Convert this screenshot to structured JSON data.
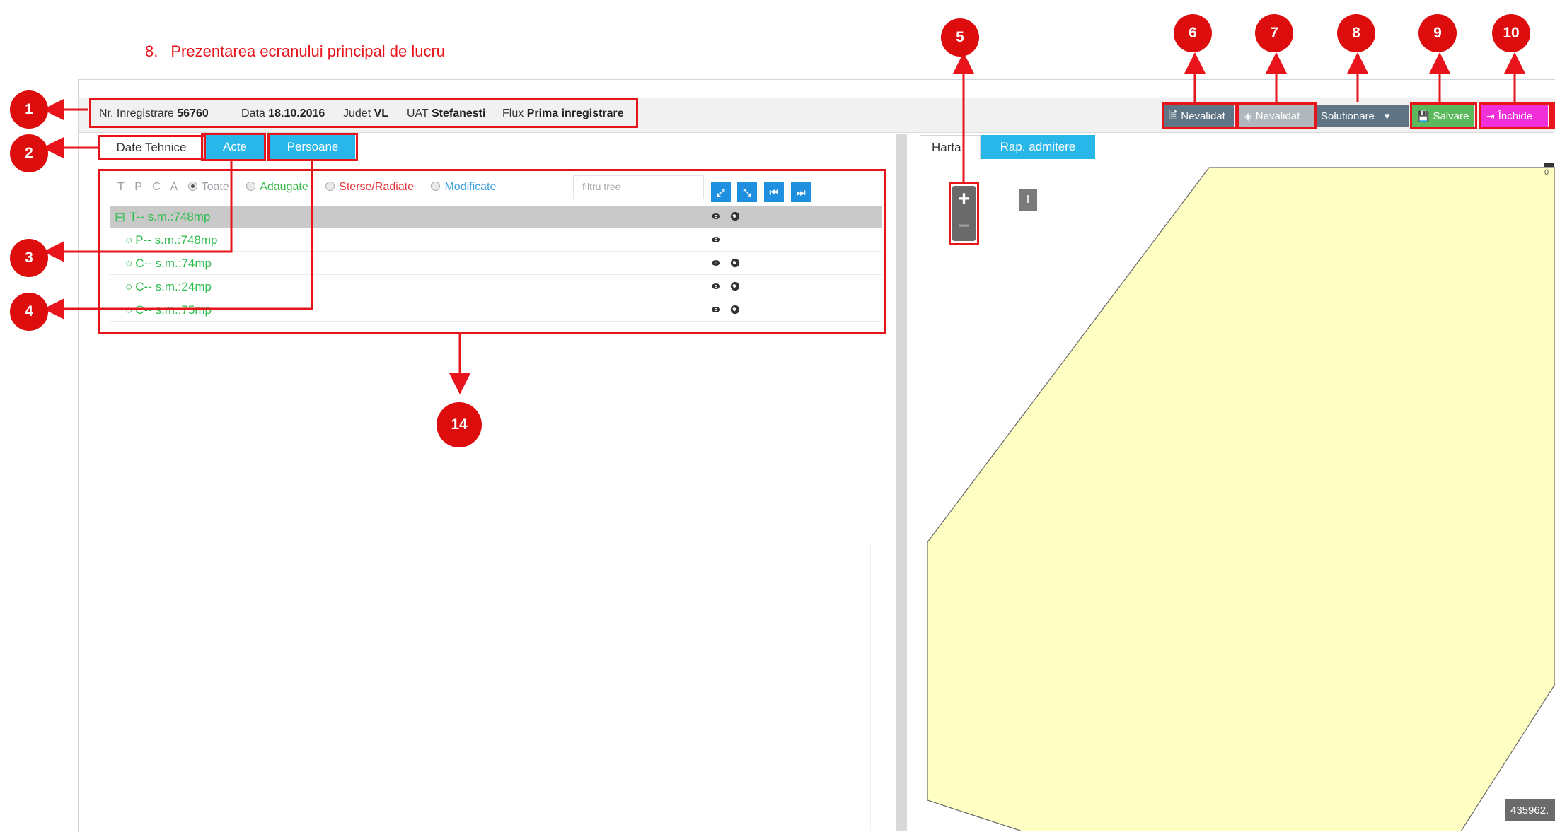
{
  "document": {
    "section_number": "8.",
    "section_title": "Prezentarea ecranului principal de lucru"
  },
  "infobar": {
    "nr_label": "Nr. Inregistrare",
    "nr_value": "56760",
    "data_label": "Data",
    "data_value": "18.10.2016",
    "judet_label": "Judet",
    "judet_value": "VL",
    "uat_label": "UAT",
    "uat_value": "Stefanesti",
    "flux_label": "Flux",
    "flux_value": "Prima inregistrare"
  },
  "toolbar": {
    "btn_nevalidat_1": "Nevalidat",
    "btn_nevalidat_2": "Nevalidat",
    "btn_solutionare": "Solutionare",
    "btn_salvare": "Salvare",
    "btn_inchide": "Închide",
    "colors": {
      "nevalidat_1": "#5f7484",
      "nevalidat_2": "#b0b8be",
      "solutionare": "#5f7484",
      "salvare": "#5cb85c",
      "inchide": "#f02fd8"
    }
  },
  "left_tabs": [
    "Date Tehnice",
    "Acte",
    "Persoane"
  ],
  "tree_filters": {
    "letters": [
      "T",
      "P",
      "C",
      "A"
    ],
    "options": [
      {
        "label": "Toate",
        "color": "#9aa0a6",
        "selected": true
      },
      {
        "label": "Adaugate",
        "color": "#3cb94e",
        "selected": false
      },
      {
        "label": "Sterse/Radiate",
        "color": "#e8363b",
        "selected": false
      },
      {
        "label": "Modificate",
        "color": "#3aa1e0",
        "selected": false
      }
    ],
    "search_placeholder": "filtru tree",
    "action_icons": [
      "expand-icon",
      "collapse-icon",
      "first-icon",
      "last-icon"
    ],
    "action_glyphs": [
      "⤢",
      "⤡",
      "⏮",
      "⏭"
    ]
  },
  "tree_rows": [
    {
      "prefix": "⊟",
      "label": "T-- s.m.:748mp",
      "eye": true,
      "globe": true,
      "selected": true
    },
    {
      "prefix": "○",
      "label": "P-- s.m.:748mp",
      "eye": true,
      "globe": false,
      "selected": false
    },
    {
      "prefix": "○",
      "label": "C-- s.m.:74mp",
      "eye": true,
      "globe": true,
      "selected": false
    },
    {
      "prefix": "○",
      "label": "C-- s.m.:24mp",
      "eye": true,
      "globe": true,
      "selected": false
    },
    {
      "prefix": "○",
      "label": "C-- s.m.:75mp",
      "eye": true,
      "globe": true,
      "selected": false
    }
  ],
  "right_tabs": [
    "Harta",
    "Rap. admitere"
  ],
  "map": {
    "zoom_in": "+",
    "zoom_out": "−",
    "tool_label": "I",
    "coordinate": "435962.",
    "scale_label": "0",
    "polygon_color": "#ffffc4"
  },
  "markers": [
    "1",
    "2",
    "3",
    "4",
    "5",
    "6",
    "7",
    "8",
    "9",
    "10",
    "14"
  ]
}
